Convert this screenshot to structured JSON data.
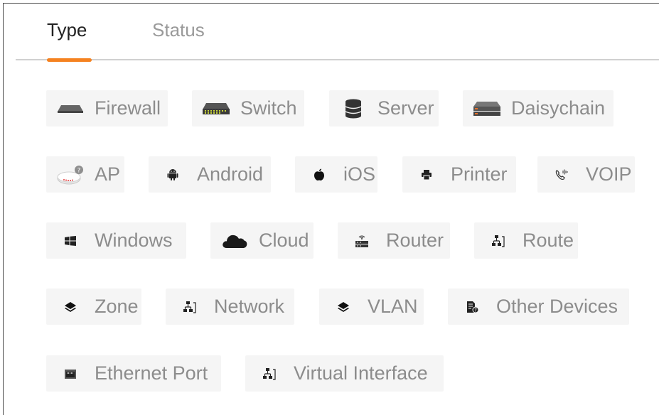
{
  "tabs": [
    {
      "label": "Type",
      "active": true
    },
    {
      "label": "Status",
      "active": false
    }
  ],
  "accent_color": "#f58220",
  "filters": [
    {
      "label": "Firewall",
      "icon": "firewall-icon"
    },
    {
      "label": "Switch",
      "icon": "switch-icon"
    },
    {
      "label": "Server",
      "icon": "server-icon"
    },
    {
      "label": "Daisychain",
      "icon": "daisychain-icon"
    },
    {
      "label": "AP",
      "icon": "access-point-icon"
    },
    {
      "label": "Android",
      "icon": "android-icon"
    },
    {
      "label": "iOS",
      "icon": "apple-icon"
    },
    {
      "label": "Printer",
      "icon": "printer-icon"
    },
    {
      "label": "VOIP",
      "icon": "voip-phone-icon"
    },
    {
      "label": "Windows",
      "icon": "windows-icon"
    },
    {
      "label": "Cloud",
      "icon": "cloud-icon"
    },
    {
      "label": "Router",
      "icon": "router-icon"
    },
    {
      "label": "Route",
      "icon": "route-icon"
    },
    {
      "label": "Zone",
      "icon": "zone-layers-icon"
    },
    {
      "label": "Network",
      "icon": "network-icon"
    },
    {
      "label": "VLAN",
      "icon": "vlan-layers-icon"
    },
    {
      "label": "Other Devices",
      "icon": "other-devices-icon"
    },
    {
      "label": "Ethernet Port",
      "icon": "ethernet-port-icon"
    },
    {
      "label": "Virtual Interface",
      "icon": "virtual-interface-icon"
    }
  ]
}
